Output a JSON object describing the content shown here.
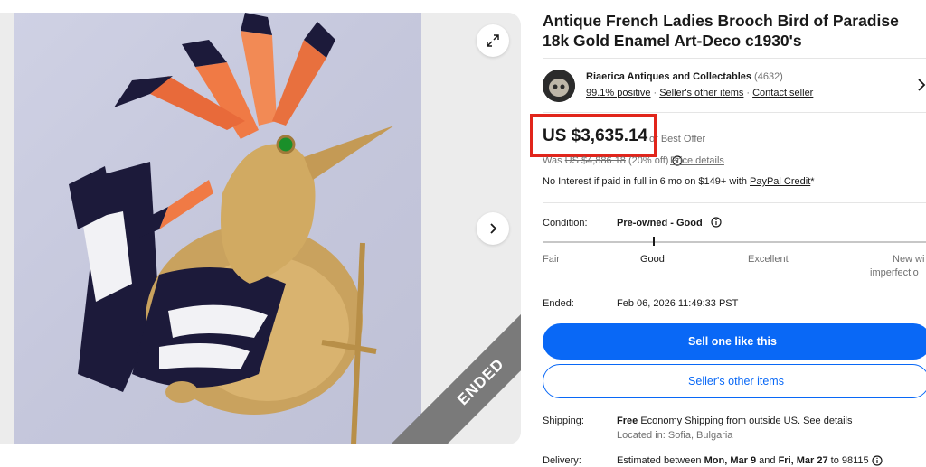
{
  "listing": {
    "title": "Antique French Ladies Brooch Bird of Paradise 18k Gold Enamel Art-Deco c1930's",
    "ended_badge": "ENDED"
  },
  "seller": {
    "name": "Riaerica Antiques and Collectables",
    "feedback_count": "(4632)",
    "positive": "99.1% positive",
    "other_items": "Seller's other items",
    "contact": "Contact seller"
  },
  "pricing": {
    "price": "US $3,635.14",
    "best_offer": "or Best Offer",
    "was_prefix": "Was",
    "was_price": "US $4,886.18",
    "was_discount": "(20% off)",
    "price_details": "Price details",
    "no_interest_text": "No Interest if paid in full in 6 mo on $149+ with",
    "paypal_credit": "PayPal Credit",
    "asterisk": "*",
    "highlight_color": "#e1251b"
  },
  "condition": {
    "label": "Condition:",
    "value": "Pre-owned - Good",
    "scale": [
      "Fair",
      "Good",
      "Excellent",
      "New wi"
    ],
    "scale_extra": "imperfectio",
    "selected": "Good"
  },
  "ended": {
    "label": "Ended:",
    "value": "Feb 06, 2026 11:49:33 PST"
  },
  "actions": {
    "sell_like_this": "Sell one like this",
    "seller_other_items": "Seller's other items",
    "primary_color": "#0968f6"
  },
  "shipping": {
    "label": "Shipping:",
    "free": "Free",
    "text": "Economy Shipping from outside US.",
    "see_details": "See details",
    "location": "Located in: Sofia, Bulgaria"
  },
  "delivery": {
    "label": "Delivery:",
    "prefix": "Estimated between",
    "start": "Mon, Mar 9",
    "and": "and",
    "end": "Fri, Mar 27",
    "to": "to 98115"
  },
  "icons": {
    "expand": "expand-icon",
    "next": "chevron-right-icon",
    "info": "info-icon"
  }
}
